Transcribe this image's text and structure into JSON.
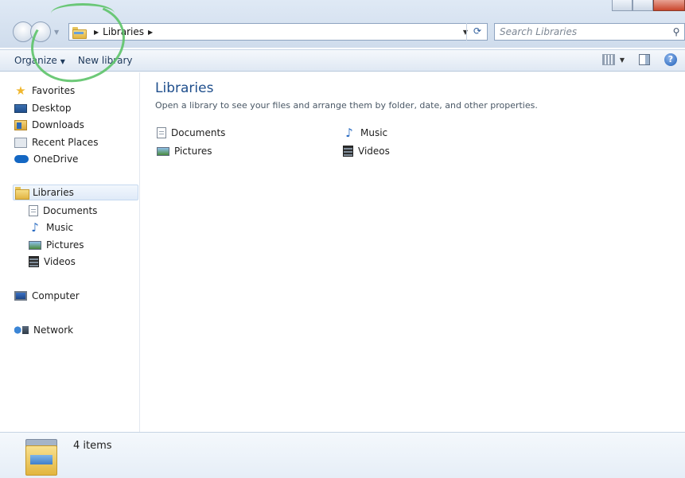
{
  "address": {
    "crumb": "Libraries",
    "search_placeholder": "Search Libraries"
  },
  "toolbar": {
    "organize_label": "Organize",
    "new_library_label": "New library"
  },
  "nav": {
    "favorites": "Favorites",
    "desktop": "Desktop",
    "downloads": "Downloads",
    "recent_places": "Recent Places",
    "onedrive": "OneDrive",
    "libraries": "Libraries",
    "documents": "Documents",
    "music": "Music",
    "pictures": "Pictures",
    "videos": "Videos",
    "computer": "Computer",
    "network": "Network"
  },
  "content": {
    "title": "Libraries",
    "description": "Open a library to see your files and arrange them by folder, date, and other properties.",
    "items": {
      "documents": "Documents",
      "music": "Music",
      "pictures": "Pictures",
      "videos": "Videos"
    }
  },
  "details": {
    "count": "4 items"
  },
  "colors": {
    "accent_title": "#1e4e8c",
    "annotation": "#5ec46a"
  }
}
